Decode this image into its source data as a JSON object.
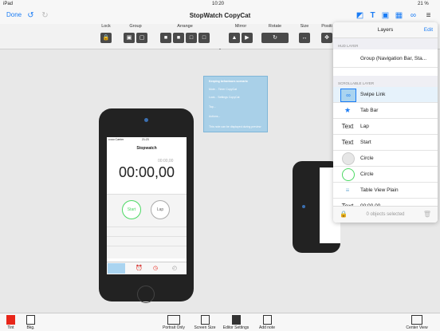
{
  "status_bar": {
    "device": "iPad",
    "time": "10:20",
    "battery": "21 %"
  },
  "nav": {
    "done": "Done",
    "title": "StopWatch CopyCat"
  },
  "toolbar": {
    "groups": [
      {
        "label": "Lock"
      },
      {
        "label": "Group"
      },
      {
        "label": "Arrange"
      },
      {
        "label": "Mirror"
      },
      {
        "label": "Rotate"
      },
      {
        "label": "Size"
      },
      {
        "label": "Positi"
      }
    ]
  },
  "phone": {
    "carrier": "•••oo Carrier",
    "clock": "21:23",
    "app_title": "Stopwatch",
    "small_time": "00:00,00",
    "big_time": "00:00,00",
    "start": "Start",
    "lap": "Lap"
  },
  "note": {
    "title": "Keeping behaviours scenario",
    "lines": [
      "Mute... Timer CopyCat",
      "Lock... Settings CopyCat",
      "Tap...",
      "Actions..."
    ],
    "footer": "This note can be displayed during preview"
  },
  "layers": {
    "title": "Layers",
    "edit": "Edit",
    "hud_label": "HUD LAYER",
    "hud_item": "Group (Navigation Bar, Sta...",
    "scroll_label": "SCROLLABLE LAYER",
    "items": [
      {
        "icon": "link-icon",
        "label": "Swipe Link"
      },
      {
        "icon": "star-icon",
        "label": "Tab Bar"
      },
      {
        "icon": "text-icon",
        "label": "Lap",
        "icon_text": "Text"
      },
      {
        "icon": "text-icon",
        "label": "Start",
        "icon_text": "Text"
      },
      {
        "icon": "circle-icon",
        "label": "Circle"
      },
      {
        "icon": "circle-icon",
        "label": "Circle"
      },
      {
        "icon": "table-icon",
        "label": "Table View Plain"
      },
      {
        "icon": "text-icon",
        "label": "00:00,00",
        "icon_text": "Text"
      }
    ],
    "footer": "0 objects selected"
  },
  "bottom": {
    "tint": "Tint",
    "bkg": "Bkg.",
    "portrait": "Portrait Only",
    "screen_size": "Screen Size",
    "editor_settings": "Editor Settings",
    "add_note": "Add note",
    "center_view": "Center View"
  },
  "colors": {
    "tint": "#e8261a",
    "accent": "#1a7cf5",
    "highlight": "#aad4f0"
  }
}
